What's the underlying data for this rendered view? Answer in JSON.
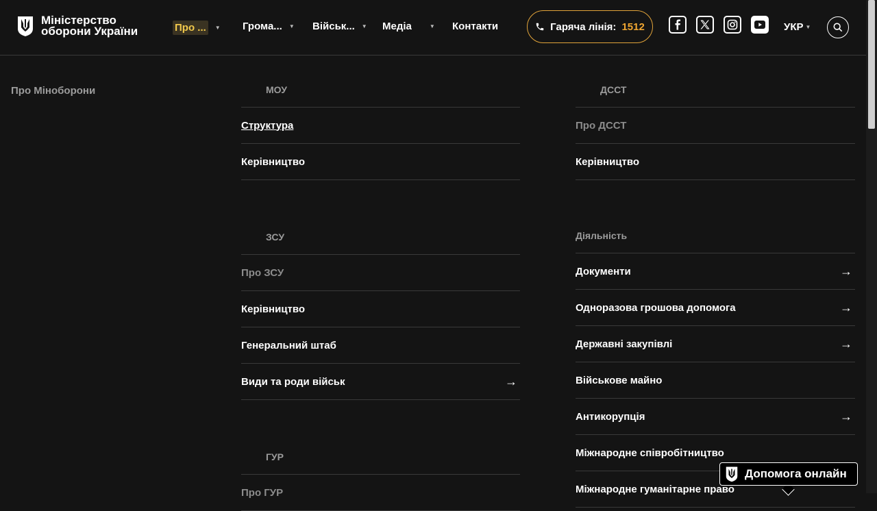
{
  "header": {
    "logo_text": "Міністерство оборони України",
    "nav": [
      {
        "label": "Про ..."
      },
      {
        "label": "Грома..."
      },
      {
        "label": "Військ..."
      },
      {
        "label": "Медіа"
      },
      {
        "label": "Контакти"
      }
    ],
    "hotline_label": "Гаряча лінія:",
    "hotline_number": "1512",
    "language": "УКР"
  },
  "menu": {
    "side_title": "Про Міноборони",
    "mou": {
      "title": "МОУ",
      "items": [
        "Структура",
        "Керівництво"
      ]
    },
    "zsu": {
      "title": "ЗСУ",
      "items": [
        "Про ЗСУ",
        "Керівництво",
        "Генеральний штаб",
        "Види та роди військ"
      ]
    },
    "gur": {
      "title": "ГУР",
      "items": [
        "Про ГУР"
      ]
    },
    "dsst": {
      "title": "ДССТ",
      "items": [
        "Про ДССТ",
        "Керівництво"
      ]
    },
    "activity": {
      "title": "Діяльність",
      "items": [
        "Документи",
        "Одноразова грошова допомога",
        "Державні закупівлі",
        "Військове майно",
        "Антикорупція",
        "Міжнародне співробітництво",
        "Міжнародне гуманітарне право"
      ]
    }
  },
  "help_button": "Допомога онлайн",
  "colors": {
    "accent": "#f0a631",
    "background": "#141414",
    "muted": "#9c9c9c"
  }
}
